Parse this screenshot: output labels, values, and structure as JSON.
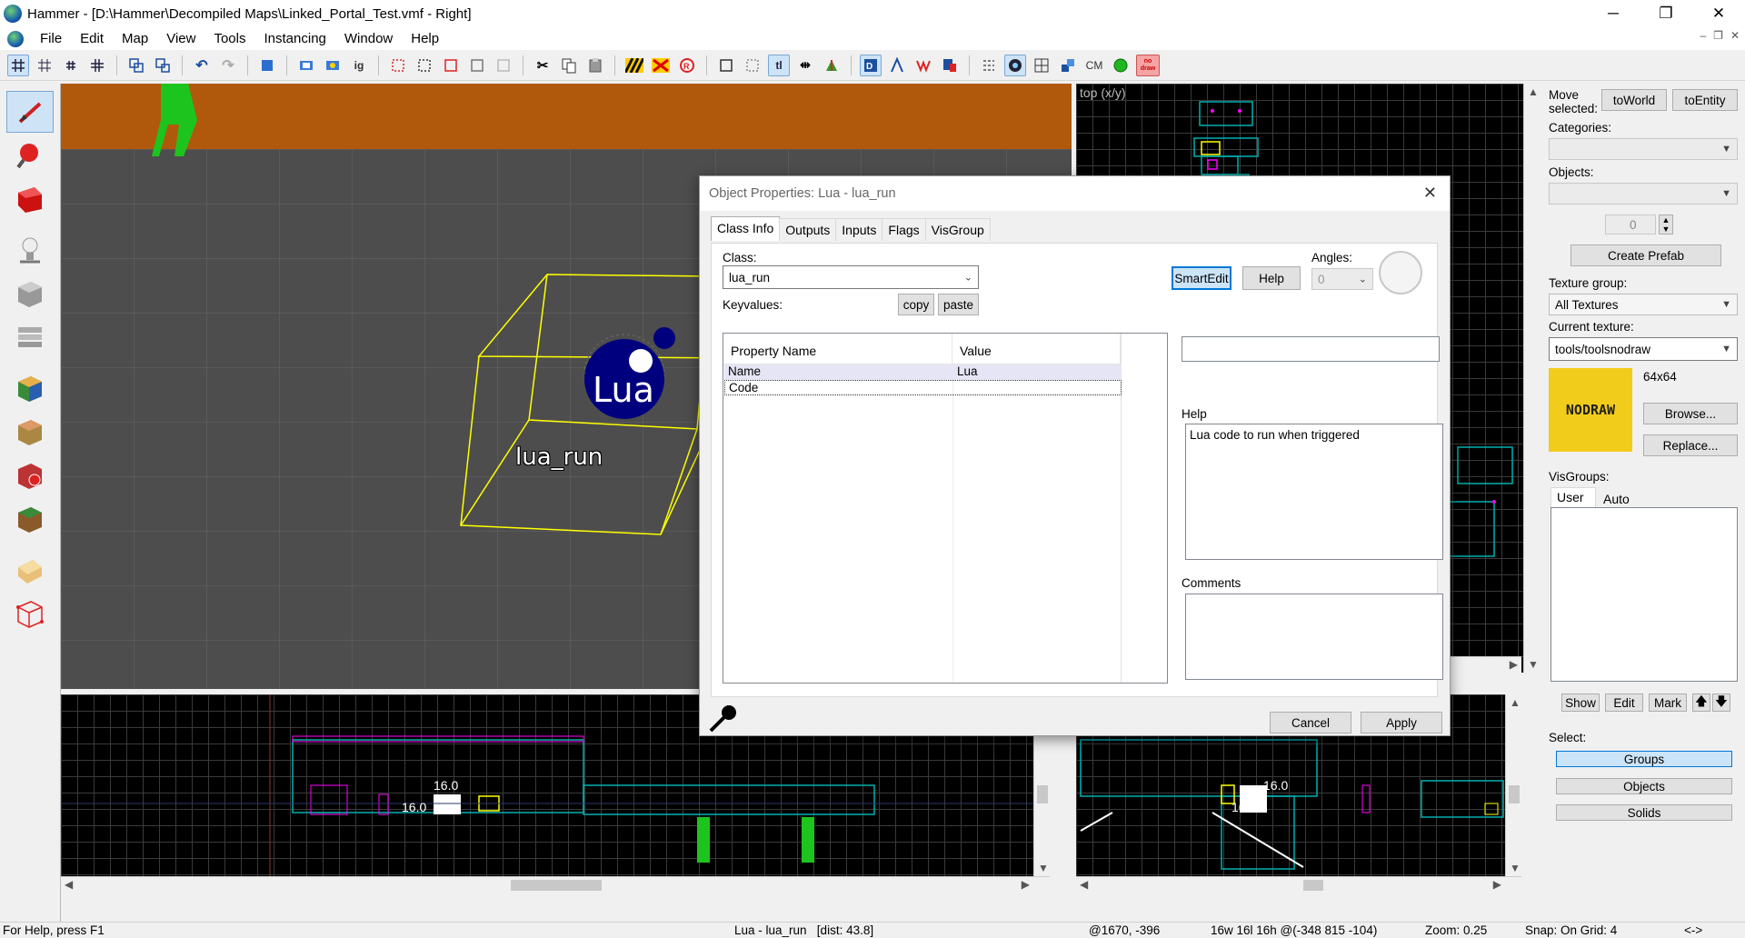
{
  "window": {
    "title": "Hammer - [D:\\Hammer\\Decompiled Maps\\Linked_Portal_Test.vmf - Right]",
    "min": "─",
    "max": "❐",
    "close": "✕"
  },
  "menu": {
    "items": [
      "File",
      "Edit",
      "Map",
      "View",
      "Tools",
      "Instancing",
      "Window",
      "Help"
    ],
    "mdi": [
      "–",
      "❐",
      "✕"
    ]
  },
  "toolbar": {
    "cm_label": "CM",
    "ig_label": "ig",
    "tl_label": "tl",
    "nodraw_label": "no draw"
  },
  "viewports": {
    "top_label": "top (x/y)",
    "entity_label": "lua_run",
    "entity_icon_text": "Lua",
    "grid_label_1": "16.0",
    "grid_label_2": "16.0",
    "grid_label_3": "16.0",
    "grid_label_4": "16.0"
  },
  "right_panel": {
    "move_selected": "Move\nselected:",
    "to_world": "toWorld",
    "to_entity": "toEntity",
    "categories": "Categories:",
    "objects": "Objects:",
    "objects_count": "0",
    "create_prefab": "Create Prefab",
    "texture_group_label": "Texture group:",
    "texture_group": "All Textures",
    "current_texture_label": "Current texture:",
    "current_texture": "tools/toolsnodraw",
    "texture_size": "64x64",
    "texture_preview": "NODRAW",
    "browse": "Browse...",
    "replace": "Replace...",
    "visgroups": "VisGroups:",
    "vis_tab_user": "User",
    "vis_tab_auto": "Auto",
    "show": "Show",
    "edit": "Edit",
    "mark": "Mark",
    "up": "🡅",
    "down": "🡇",
    "select_label": "Select:",
    "groups": "Groups",
    "objects_btn": "Objects",
    "solids": "Solids"
  },
  "dialog": {
    "title": "Object Properties: Lua - lua_run",
    "tabs": [
      "Class Info",
      "Outputs",
      "Inputs",
      "Flags",
      "VisGroup"
    ],
    "class_label": "Class:",
    "class_value": "lua_run",
    "keyvalues_label": "Keyvalues:",
    "copy": "copy",
    "paste": "paste",
    "smartedit": "SmartEdit",
    "help_btn": "Help",
    "angles_label": "Angles:",
    "angles_value": "0",
    "col_property": "Property Name",
    "col_value": "Value",
    "rows": [
      {
        "name": "Name",
        "value": "Lua"
      },
      {
        "name": "Code",
        "value": ""
      }
    ],
    "help_label": "Help",
    "help_text": "Lua code to run when triggered",
    "comments_label": "Comments",
    "cancel": "Cancel",
    "apply": "Apply"
  },
  "status": {
    "help": "For Help, press F1",
    "selection": "Lua - lua_run   [dist: 43.8]",
    "coords": "@1670, -396",
    "size": "16w 16l 16h @(-348 815 -104)",
    "zoom": "Zoom: 0.25",
    "snap": "Snap: On Grid: 4",
    "arrows": "<->"
  },
  "colors": {
    "accent": "#0078d7",
    "texture_yellow": "#f2cc1b",
    "grid_cyan": "#00b0b0",
    "grid_magenta": "#ff00ff",
    "selection_yellow": "#ffff00"
  }
}
